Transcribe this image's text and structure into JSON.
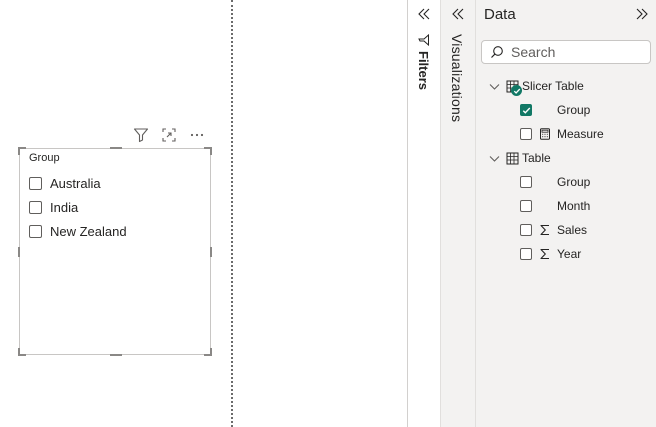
{
  "canvas": {
    "slicer": {
      "title": "Group",
      "items": [
        {
          "label": "Australia",
          "checked": false
        },
        {
          "label": "India",
          "checked": false
        },
        {
          "label": "New Zealand",
          "checked": false
        }
      ]
    },
    "visual_header_icons": [
      "filter-icon",
      "focus-mode-icon",
      "more-options-icon"
    ]
  },
  "panes": {
    "filters": {
      "label": "Filters",
      "icon": "filter-icon",
      "collapse_icon": "double-chevron-left-icon"
    },
    "visualizations": {
      "label": "Visualizations",
      "collapse_icon": "double-chevron-left-icon"
    },
    "data": {
      "title": "Data",
      "expand_icon": "double-chevron-right-icon",
      "search": {
        "placeholder": "Search",
        "value": ""
      },
      "tables": [
        {
          "name": "Slicer Table",
          "expanded": true,
          "in_use": true,
          "fields": [
            {
              "name": "Group",
              "checked": true,
              "type": "column"
            },
            {
              "name": "Measure",
              "checked": false,
              "type": "measure"
            }
          ]
        },
        {
          "name": "Table",
          "expanded": true,
          "in_use": false,
          "fields": [
            {
              "name": "Group",
              "checked": false,
              "type": "column"
            },
            {
              "name": "Month",
              "checked": false,
              "type": "column"
            },
            {
              "name": "Sales",
              "checked": false,
              "type": "sum"
            },
            {
              "name": "Year",
              "checked": false,
              "type": "sum"
            }
          ]
        }
      ]
    }
  },
  "colors": {
    "accent": "#117865",
    "pane_bg": "#f3f2f1",
    "border": "#c8c6c4",
    "text": "#252423"
  }
}
